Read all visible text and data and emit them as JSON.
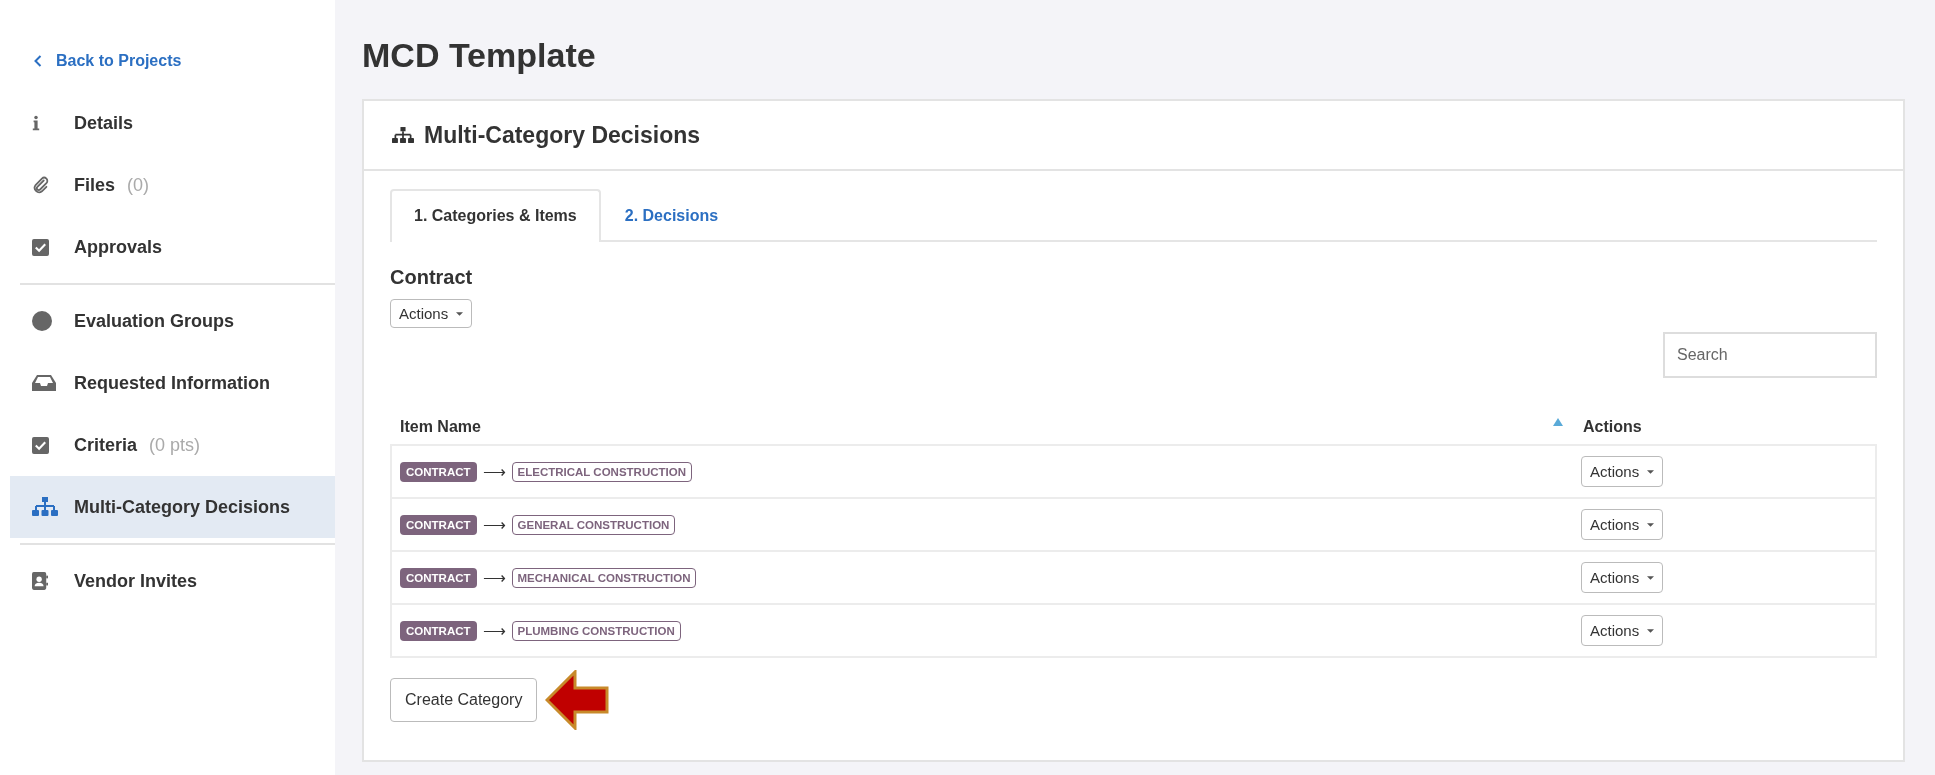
{
  "sidebar": {
    "back_link": "Back to Projects",
    "sections": [
      [
        {
          "label": "Details",
          "selected": false
        },
        {
          "label": "Files",
          "count": "(0)",
          "selected": false
        },
        {
          "label": "Approvals",
          "selected": false
        }
      ],
      [
        {
          "label": "Evaluation Groups",
          "selected": false
        },
        {
          "label": "Requested Information",
          "selected": false
        },
        {
          "label": "Criteria",
          "count": "(0 pts)",
          "selected": false
        },
        {
          "label": "Multi-Category Decisions",
          "selected": true
        }
      ],
      [
        {
          "label": "Vendor Invites",
          "selected": false
        }
      ]
    ]
  },
  "page_title": "MCD Template",
  "panel": {
    "title": "Multi-Category Decisions",
    "tabs": [
      {
        "label": "1. Categories & Items",
        "selected": true
      },
      {
        "label": "2. Decisions",
        "selected": false
      }
    ],
    "section_title": "Contract",
    "actions_button": "Actions",
    "search": {
      "placeholder": "Search"
    },
    "table": {
      "columns": [
        {
          "label": "Item Name",
          "sorted": true
        },
        {
          "label": "Actions",
          "sorted": false
        }
      ],
      "rows": [
        {
          "category": "CONTRACT",
          "separator": "⟶",
          "item": "ELECTRICAL CONSTRUCTION",
          "action": "Actions"
        },
        {
          "category": "CONTRACT",
          "separator": "⟶",
          "item": "GENERAL CONSTRUCTION",
          "action": "Actions"
        },
        {
          "category": "CONTRACT",
          "separator": "⟶",
          "item": "MECHANICAL CONSTRUCTION",
          "action": "Actions"
        },
        {
          "category": "CONTRACT",
          "separator": "⟶",
          "item": "PLUMBING CONSTRUCTION",
          "action": "Actions"
        }
      ]
    },
    "create_button": "Create Category"
  }
}
